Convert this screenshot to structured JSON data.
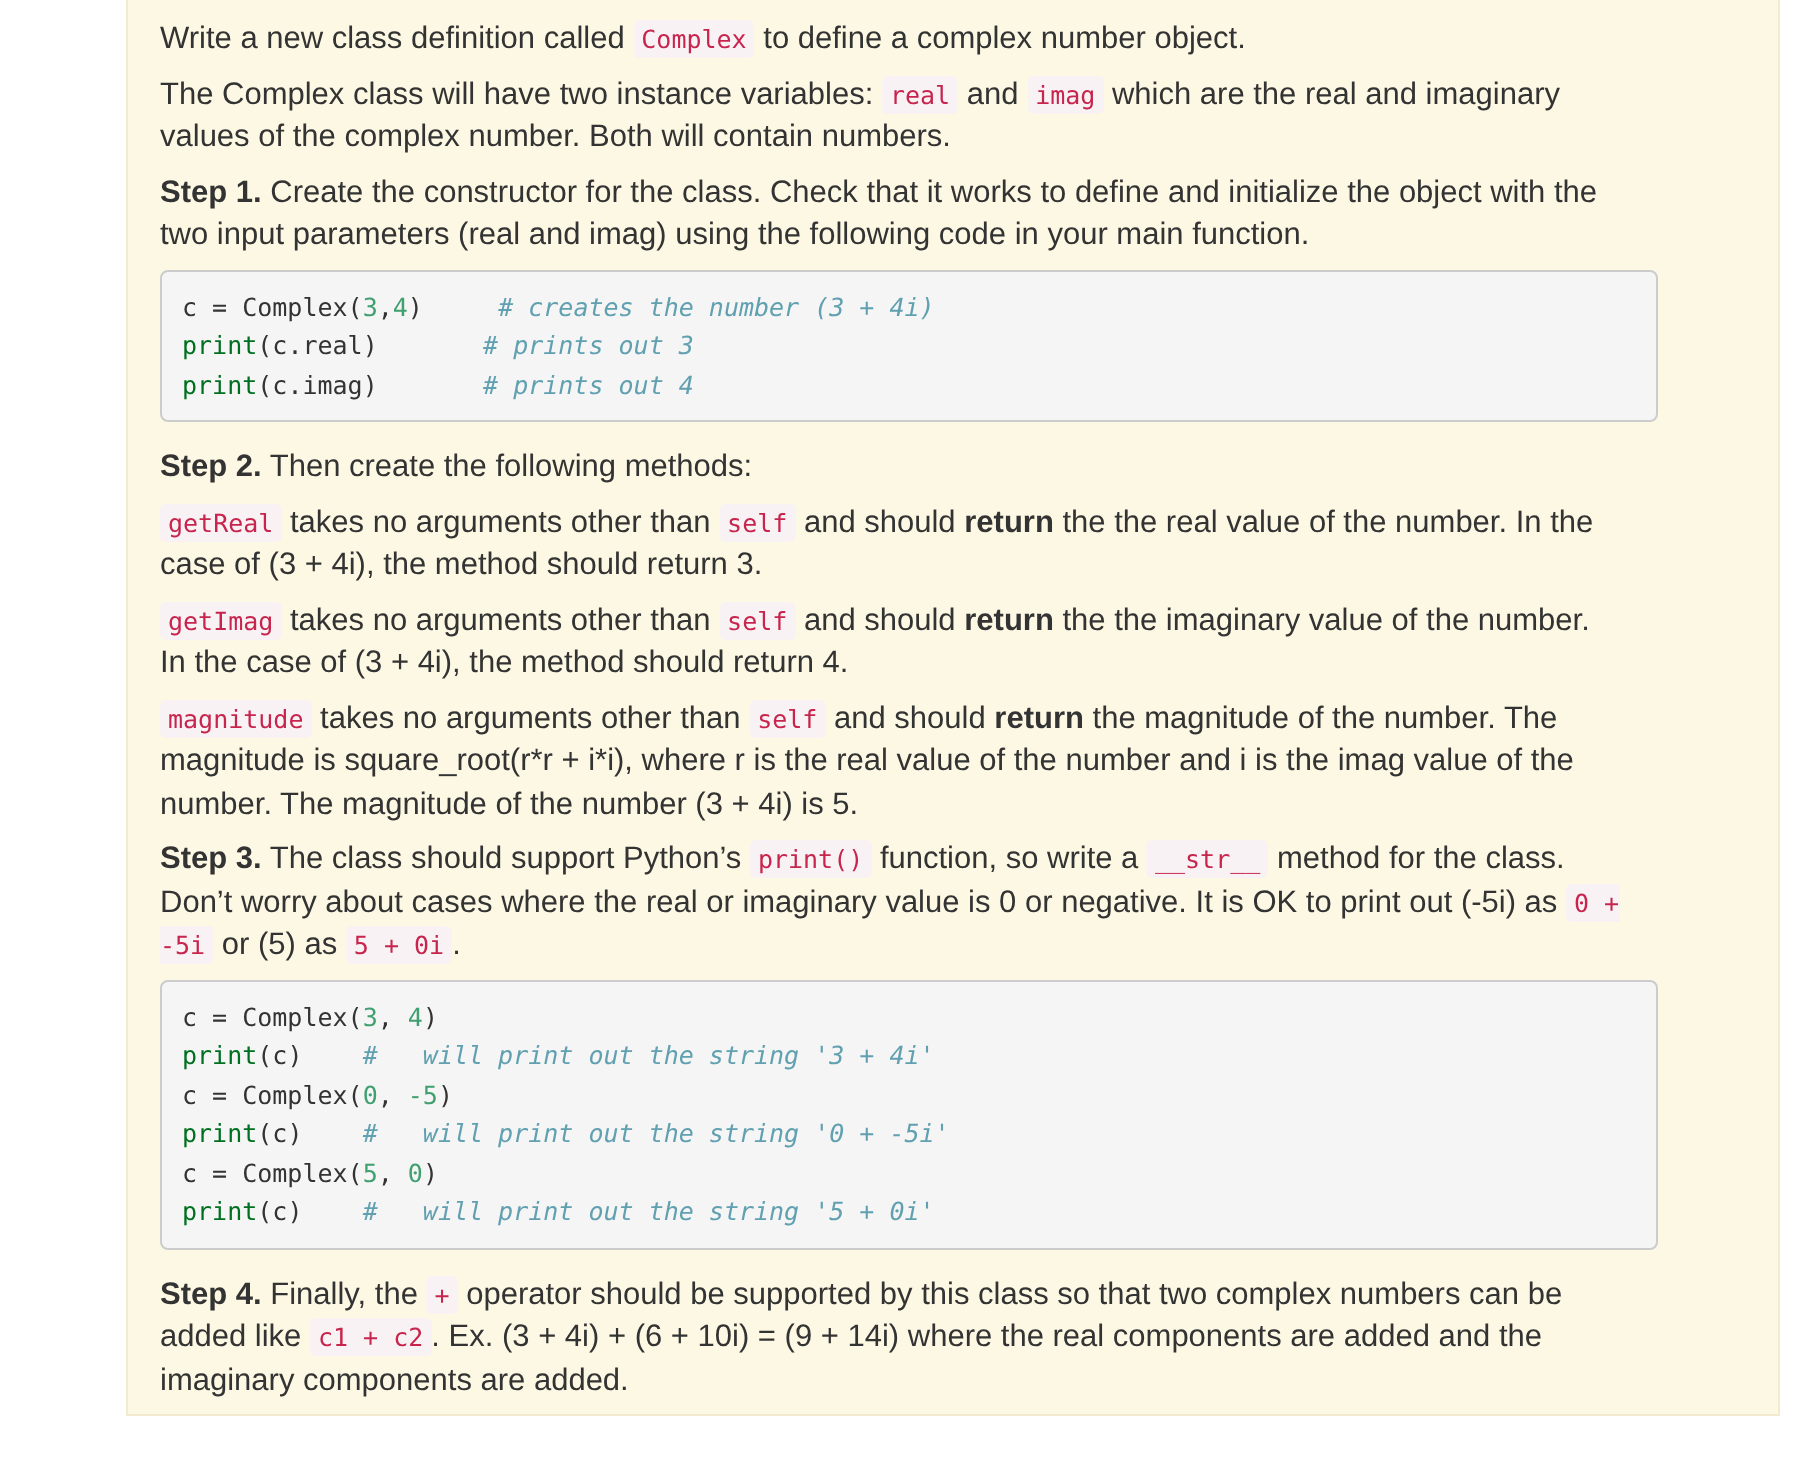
{
  "blocks": [
    {
      "kind": "para",
      "parts": [
        {
          "kind": "text",
          "text": "Write a new class definition called "
        },
        {
          "kind": "code",
          "text": "Complex"
        },
        {
          "kind": "text",
          "text": " to define a complex number object."
        }
      ]
    },
    {
      "kind": "para",
      "parts": [
        {
          "kind": "text",
          "text": "The Complex class will have two instance variables: "
        },
        {
          "kind": "code",
          "text": "real"
        },
        {
          "kind": "text",
          "text": " and "
        },
        {
          "kind": "code",
          "text": "imag"
        },
        {
          "kind": "text",
          "text": " which are the real and imaginary values of the complex number. Both will contain numbers."
        }
      ]
    },
    {
      "kind": "para",
      "parts": [
        {
          "kind": "text",
          "text": "**Step 1.** Create the constructor for the class. Check that it works to define and initialize the object with the two input parameters (real and imag) using the following code in your main function."
        }
      ]
    },
    {
      "kind": "codeblock",
      "lines": [
        [
          {
            "kind": "plain",
            "text": "c = Complex("
          },
          {
            "kind": "number",
            "text": "3"
          },
          {
            "kind": "plain",
            "text": ","
          },
          {
            "kind": "number",
            "text": "4"
          },
          {
            "kind": "plain",
            "text": ")     "
          },
          {
            "kind": "comment",
            "text": "# creates the number (3 + 4i)"
          }
        ],
        [
          {
            "kind": "builtin",
            "text": "print"
          },
          {
            "kind": "plain",
            "text": "(c.real)       "
          },
          {
            "kind": "comment",
            "text": "# prints out 3"
          }
        ],
        [
          {
            "kind": "builtin",
            "text": "print"
          },
          {
            "kind": "plain",
            "text": "(c.imag)       "
          },
          {
            "kind": "comment",
            "text": "# prints out 4"
          }
        ]
      ]
    },
    {
      "kind": "para",
      "parts": [
        {
          "kind": "text",
          "text": "**Step 2.** Then create the following methods:"
        }
      ]
    },
    {
      "kind": "para",
      "parts": [
        {
          "kind": "code",
          "text": "getReal"
        },
        {
          "kind": "text",
          "text": " takes no arguments other than "
        },
        {
          "kind": "code",
          "text": "self"
        },
        {
          "kind": "text",
          "text": " and should **return** the the real value of the number. In the case of (3 + 4i), the method should return 3."
        }
      ]
    },
    {
      "kind": "para",
      "parts": [
        {
          "kind": "code",
          "text": "getImag"
        },
        {
          "kind": "text",
          "text": " takes no arguments other than "
        },
        {
          "kind": "code",
          "text": "self"
        },
        {
          "kind": "text",
          "text": " and should **return** the the imaginary value of the number. In the case of (3 + 4i), the method should return 4."
        }
      ]
    },
    {
      "kind": "para",
      "parts": [
        {
          "kind": "code",
          "text": "magnitude"
        },
        {
          "kind": "text",
          "text": " takes no arguments other than "
        },
        {
          "kind": "code",
          "text": "self"
        },
        {
          "kind": "text",
          "text": " and should **return** the magnitude of the number. The magnitude is square_root(r*r + i*i), where r is the real value of the number and i is the imag value of the number. The magnitude of the number (3 + 4i) is 5."
        }
      ]
    },
    {
      "kind": "para",
      "parts": [
        {
          "kind": "text",
          "text": "**Step 3.** The class should support Python’s "
        },
        {
          "kind": "code",
          "text": "print()"
        },
        {
          "kind": "text",
          "text": " function, so write a "
        },
        {
          "kind": "code",
          "text": "__str__"
        },
        {
          "kind": "text",
          "text": " method for the class. Don’t worry about cases where the real or imaginary value is 0 or negative. It is OK to print out (-5i) as "
        },
        {
          "kind": "code",
          "text": "0 + -5i"
        },
        {
          "kind": "text",
          "text": " or (5) as "
        },
        {
          "kind": "code",
          "text": "5 + 0i"
        },
        {
          "kind": "text",
          "text": "."
        }
      ]
    },
    {
      "kind": "codeblock",
      "lines": [
        [
          {
            "kind": "plain",
            "text": "c = Complex("
          },
          {
            "kind": "number",
            "text": "3"
          },
          {
            "kind": "plain",
            "text": ", "
          },
          {
            "kind": "number",
            "text": "4"
          },
          {
            "kind": "plain",
            "text": ")"
          }
        ],
        [
          {
            "kind": "builtin",
            "text": "print"
          },
          {
            "kind": "plain",
            "text": "(c)    "
          },
          {
            "kind": "comment",
            "text": "#   will print out the string '3 + 4i'"
          }
        ],
        [
          {
            "kind": "plain",
            "text": "c = Complex("
          },
          {
            "kind": "number",
            "text": "0"
          },
          {
            "kind": "plain",
            "text": ", "
          },
          {
            "kind": "number",
            "text": "-5"
          },
          {
            "kind": "plain",
            "text": ")"
          }
        ],
        [
          {
            "kind": "builtin",
            "text": "print"
          },
          {
            "kind": "plain",
            "text": "(c)    "
          },
          {
            "kind": "comment",
            "text": "#   will print out the string '0 + -5i'"
          }
        ],
        [
          {
            "kind": "plain",
            "text": "c = Complex("
          },
          {
            "kind": "number",
            "text": "5"
          },
          {
            "kind": "plain",
            "text": ", "
          },
          {
            "kind": "number",
            "text": "0"
          },
          {
            "kind": "plain",
            "text": ")"
          }
        ],
        [
          {
            "kind": "builtin",
            "text": "print"
          },
          {
            "kind": "plain",
            "text": "(c)    "
          },
          {
            "kind": "comment",
            "text": "#   will print out the string '5 + 0i'"
          }
        ]
      ]
    },
    {
      "kind": "para",
      "parts": [
        {
          "kind": "text",
          "text": "**Step 4.** Finally, the "
        },
        {
          "kind": "code",
          "text": "+"
        },
        {
          "kind": "text",
          "text": " operator should be supported by this class so that two complex numbers can be added like "
        },
        {
          "kind": "code",
          "text": "c1 + c2"
        },
        {
          "kind": "text",
          "text": ". Ex. (3 + 4i) + (6 + 10i) = (9 + 14i) where the real components are added and the imaginary components are added."
        }
      ]
    }
  ]
}
